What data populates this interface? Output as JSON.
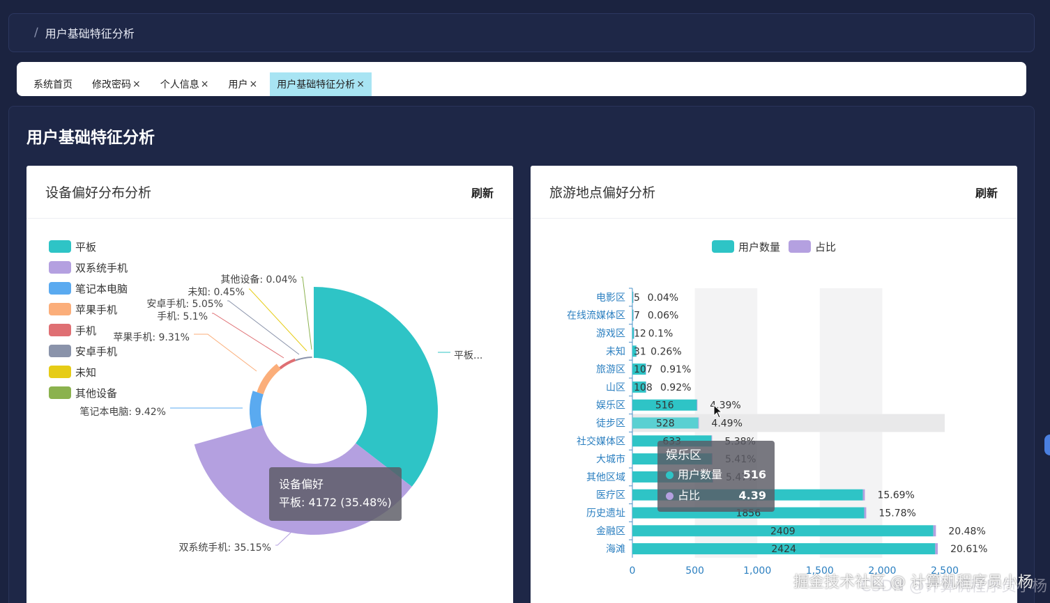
{
  "breadcrumb": {
    "separator": "/",
    "current": "用户基础特征分析"
  },
  "tabs": [
    {
      "label": "系统首页",
      "closable": false,
      "active": false
    },
    {
      "label": "修改密码",
      "closable": true,
      "active": false
    },
    {
      "label": "个人信息",
      "closable": true,
      "active": false
    },
    {
      "label": "用户",
      "closable": true,
      "active": false
    },
    {
      "label": "用户基础特征分析",
      "closable": true,
      "active": true
    }
  ],
  "close_glyph": "×",
  "page_title": "用户基础特征分析",
  "left_card": {
    "title": "设备偏好分布分析",
    "refresh_label": "刷新"
  },
  "right_card": {
    "title": "旅游地点偏好分析",
    "refresh_label": "刷新"
  },
  "device_tooltip": {
    "title": "设备偏好",
    "text": "平板: 4172 (35.48%)"
  },
  "place_tooltip": {
    "title": "娱乐区",
    "rows": [
      {
        "name": "用户数量",
        "value": "516",
        "color": "#2ec4c6"
      },
      {
        "name": "占比",
        "value": "4.39",
        "color": "#b4a0e0"
      }
    ]
  },
  "watermark": "掘金技术社区 @ 计算机程序员小杨",
  "watermark_faint": "CSDN @计算机程序员小杨",
  "chart_data": [
    {
      "type": "pie",
      "title": "",
      "legend_position": "left",
      "labels": [
        "平板",
        "双系统手机",
        "笔记本电脑",
        "苹果手机",
        "手机",
        "安卓手机",
        "未知",
        "其他设备"
      ],
      "colors": [
        "#2ec4c6",
        "#b4a0e0",
        "#5aaaf0",
        "#fbae7a",
        "#df6f73",
        "#8a93aa",
        "#e6cc16",
        "#8bb24e"
      ],
      "percents": [
        35.48,
        35.15,
        9.42,
        9.31,
        5.1,
        5.05,
        0.45,
        0.04
      ],
      "slice_labels": [
        "平板...",
        "双系统手机: 35.15%",
        "笔记本电脑: 9.42%",
        "苹果手机: 9.31%",
        "手机: 5.1%",
        "安卓手机: 5.05%",
        "未知: 0.45%",
        "其他设备: 0.04%"
      ],
      "values_known": {
        "平板": 4172
      }
    },
    {
      "type": "bar",
      "orientation": "horizontal",
      "title": "",
      "legend_position": "top-center",
      "categories": [
        "电影区",
        "在线流媒体区",
        "游戏区",
        "未知",
        "旅游区",
        "山区",
        "娱乐区",
        "徒步区",
        "社交媒体区",
        "大城市",
        "其他区域",
        "医疗区",
        "历史遗址",
        "金融区",
        "海滩"
      ],
      "series": [
        {
          "name": "用户数量",
          "color": "#2ec4c6",
          "values": [
            5,
            7,
            12,
            31,
            107,
            108,
            516,
            528,
            633,
            636,
            642,
            1845,
            1856,
            2409,
            2424
          ],
          "labels": [
            "5",
            "7",
            "12",
            "31",
            "107",
            "108",
            "516",
            "528",
            "633",
            "",
            "",
            "",
            "1856",
            "2409",
            "2424"
          ]
        },
        {
          "name": "占比",
          "color": "#b4a0e0",
          "values": [
            0.04,
            0.06,
            0.1,
            0.26,
            0.91,
            0.92,
            4.39,
            4.49,
            5.38,
            5.41,
            5.47,
            15.69,
            15.78,
            20.48,
            20.61
          ],
          "labels": [
            "0.04%",
            "0.06%",
            "0.1%",
            "0.26%",
            "0.91%",
            "0.92%",
            "4.39%",
            "4.49%",
            "5.38%",
            "5.41%",
            "5.47%",
            "15.69%",
            "15.78%",
            "20.48%",
            "20.61%"
          ]
        }
      ],
      "x_ticks": [
        "0",
        "500",
        "1,000",
        "1,500",
        "2,000",
        "2,500"
      ],
      "xlim": [
        0,
        2500
      ],
      "highlighted_category": "徒步区",
      "split_area": true
    }
  ]
}
